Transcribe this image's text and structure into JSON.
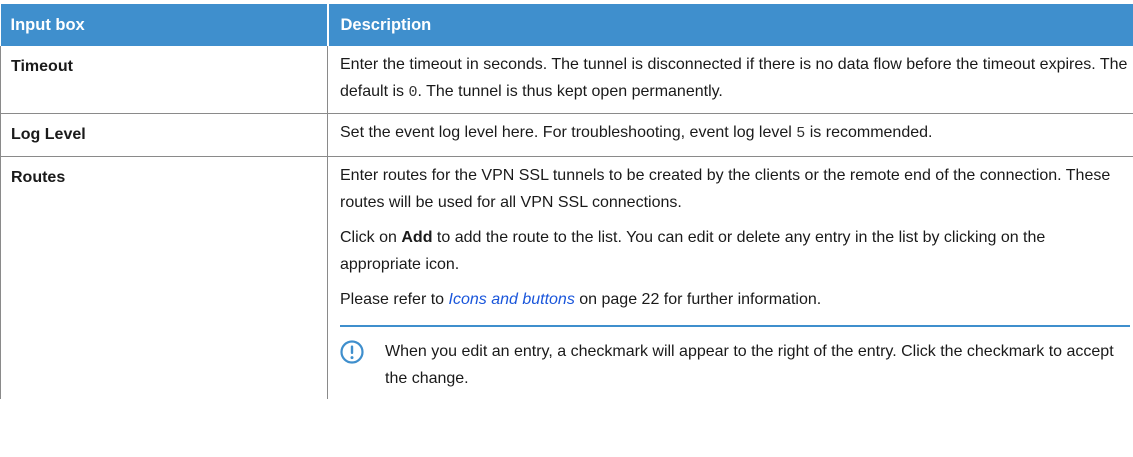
{
  "table": {
    "headers": [
      "Input box",
      "Description"
    ],
    "rows": {
      "timeout": {
        "key": "Timeout",
        "desc_part1": "Enter the timeout in seconds. The tunnel is disconnected if there is no data flow before the timeout expires. The default is ",
        "desc_code": "0",
        "desc_part2": ". The tunnel is thus kept open permanently."
      },
      "log_level": {
        "key": "Log Level",
        "desc_part1": "Set the event log level here. For troubleshooting, event log level ",
        "desc_code": "5",
        "desc_part2": " is recommended."
      },
      "routes": {
        "key": "Routes",
        "para1": "Enter routes for the VPN SSL tunnels to be created by the clients or the remote end of the connection. These routes will be used for all VPN SSL connections.",
        "para2_prefix": "Click on ",
        "para2_bold": "Add",
        "para2_suffix": " to add the route to the list. You can edit or delete any entry in the list by clicking on the appropriate icon.",
        "para3_prefix": "Please refer to ",
        "para3_link": "Icons and buttons",
        "para3_suffix": " on page 22 for further information.",
        "note_icon": "exclamation-circle-icon",
        "note_text": "When you edit an entry, a checkmark will appear to the right of the entry. Click the checkmark to accept the change."
      }
    }
  },
  "colors": {
    "header_bg": "#3f8fcd",
    "header_text": "#ffffff",
    "link": "#1a56db",
    "note_rule": "#3f8fcd"
  }
}
